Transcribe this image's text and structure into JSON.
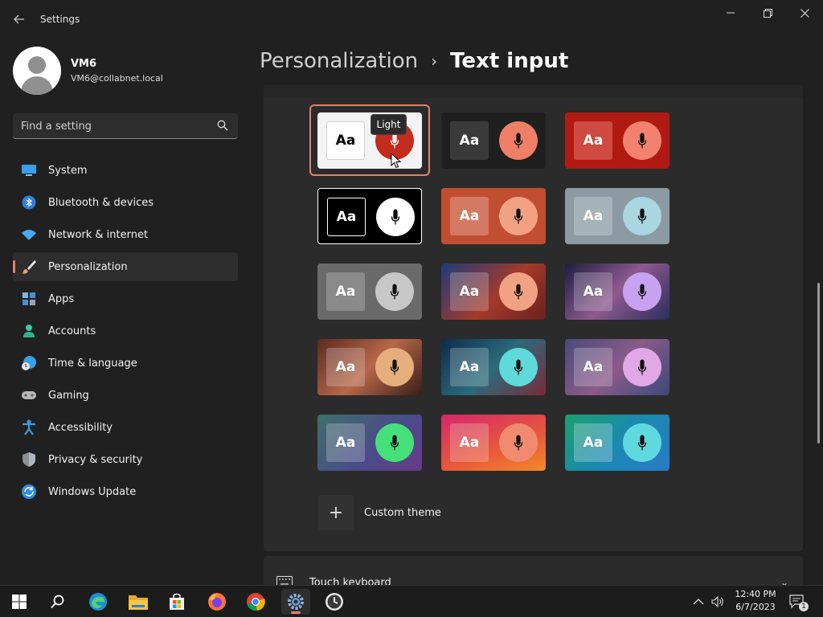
{
  "window": {
    "title": "Settings",
    "controls": {
      "minimize": "—",
      "maximize": "❐",
      "close": "✕"
    }
  },
  "user": {
    "name": "VM6",
    "email": "VM6@collabnet.local"
  },
  "search": {
    "placeholder": "Find a setting"
  },
  "sidebar": {
    "items": [
      {
        "label": "System",
        "icon": "system-icon"
      },
      {
        "label": "Bluetooth & devices",
        "icon": "bluetooth-icon"
      },
      {
        "label": "Network & internet",
        "icon": "wifi-icon"
      },
      {
        "label": "Personalization",
        "icon": "brush-icon",
        "active": true
      },
      {
        "label": "Apps",
        "icon": "apps-icon"
      },
      {
        "label": "Accounts",
        "icon": "accounts-icon"
      },
      {
        "label": "Time & language",
        "icon": "clock-globe-icon"
      },
      {
        "label": "Gaming",
        "icon": "gamepad-icon"
      },
      {
        "label": "Accessibility",
        "icon": "accessibility-icon"
      },
      {
        "label": "Privacy & security",
        "icon": "shield-icon"
      },
      {
        "label": "Windows Update",
        "icon": "update-icon"
      }
    ]
  },
  "breadcrumb": {
    "parent": "Personalization",
    "separator": "›",
    "current": "Text input"
  },
  "themes": {
    "key_label": "Aa",
    "tooltip": "Light",
    "selected_index": 0,
    "tiles": [
      {
        "bg": "#f3f3f3",
        "key_bg": "#ffffff",
        "key_fg": "#000000",
        "mic_bg": "#c42b1c",
        "mic_fg": "#ffffff"
      },
      {
        "bg": "#1f1f1f",
        "key_bg": "#3a3a3a",
        "key_fg": "#ffffff",
        "mic_bg": "#ef7f66",
        "mic_fg": "#111111"
      },
      {
        "bg": "#b01a12",
        "key_bg": "#cf4a40",
        "key_fg": "#ffffff",
        "mic_bg": "#f2826f",
        "mic_fg": "#111111"
      },
      {
        "bg": "#000000",
        "key_bg": "#000000",
        "key_fg": "#ffffff",
        "mic_bg": "#ffffff",
        "mic_fg": "#000000",
        "border": "#ffffff"
      },
      {
        "bg": "#c24e32",
        "key_bg": "#d47a62",
        "key_fg": "#ffffff",
        "mic_bg": "#f2a283",
        "mic_fg": "#111111"
      },
      {
        "bg": "#8c9aa3",
        "key_bg": "#a7b3ba",
        "key_fg": "#ffffff",
        "mic_bg": "#a9d6e0",
        "mic_fg": "#111111"
      },
      {
        "bg": "#6a6a6a",
        "key_bg": "#8a8a8a",
        "key_fg": "#ffffff",
        "mic_bg": "#c7c7c7",
        "mic_fg": "#111111"
      },
      {
        "bg": "linear-gradient(135deg,#1f3b7a,#a33a2a 55%,#6b1f1f)",
        "key_bg": "rgba(255,255,255,0.22)",
        "key_fg": "#ffffff",
        "mic_bg": "#f2a283",
        "mic_fg": "#111111"
      },
      {
        "bg": "linear-gradient(135deg,#1d1d3f,#8d5a8f 50%,#2c2c5a)",
        "key_bg": "rgba(255,255,255,0.22)",
        "key_fg": "#ffffff",
        "mic_bg": "#c8a2f0",
        "mic_fg": "#111111"
      },
      {
        "bg": "linear-gradient(135deg,#5a2a1f,#b7674a 50%,#3a1d18)",
        "key_bg": "rgba(255,255,255,0.22)",
        "key_fg": "#ffffff",
        "mic_bg": "#e6ae7a",
        "mic_fg": "#111111"
      },
      {
        "bg": "linear-gradient(135deg,#0e2b4d,#2b6a7a 50%,#7a2a3a)",
        "key_bg": "rgba(255,255,255,0.22)",
        "key_fg": "#ffffff",
        "mic_bg": "#5fd9d9",
        "mic_fg": "#111111"
      },
      {
        "bg": "linear-gradient(135deg,#4a4a7a,#8a5a8a 50%,#3a4a7a)",
        "key_bg": "rgba(255,255,255,0.22)",
        "key_fg": "#ffffff",
        "mic_bg": "#e0a8e6",
        "mic_fg": "#111111"
      },
      {
        "bg": "linear-gradient(135deg,#3e6f6a,#4b4a8a 60%,#6a3a8a)",
        "key_bg": "rgba(255,255,255,0.22)",
        "key_fg": "#ffffff",
        "mic_bg": "#45e07a",
        "mic_fg": "#111111"
      },
      {
        "bg": "linear-gradient(160deg,#d4286a,#e85a3a 60%,#f28a2a)",
        "key_bg": "rgba(255,255,255,0.22)",
        "key_fg": "#ffffff",
        "mic_bg": "#f28a6f",
        "mic_fg": "#111111"
      },
      {
        "bg": "linear-gradient(135deg,#1aa06a,#1a8ab0 50%,#2a7ac8)",
        "key_bg": "rgba(255,255,255,0.25)",
        "key_fg": "#ffffff",
        "mic_bg": "#5fd9e0",
        "mic_fg": "#111111"
      }
    ]
  },
  "custom_theme": {
    "plus": "+",
    "label": "Custom theme"
  },
  "touch_keyboard": {
    "label": "Touch keyboard",
    "chevron": "⌄"
  },
  "taskbar": {
    "apps": [
      "start-icon",
      "search-icon",
      "edge-icon",
      "file-explorer-icon",
      "store-icon",
      "firefox-icon",
      "chrome-icon",
      "settings-icon",
      "clock-app-icon"
    ],
    "active_app": "settings-icon",
    "tray": {
      "chevron": "^",
      "volume": "🔊"
    },
    "time": "12:40 PM",
    "date": "6/7/2023",
    "notification_count": "1"
  },
  "accent_color": "#e0836a"
}
